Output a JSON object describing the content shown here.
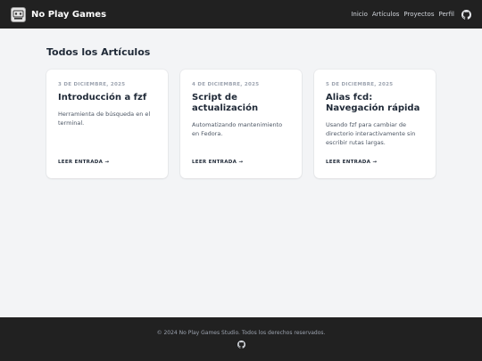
{
  "header": {
    "site_title": "No Play Games",
    "logo_icon": "brand-logo-icon",
    "nav": [
      "Inicio",
      "Artículos",
      "Proyectos",
      "Perfil"
    ],
    "github_icon": "github-icon"
  },
  "main": {
    "section_title": "Todos los Artículos",
    "articles": [
      {
        "date": "3 DE DICIEMBRE, 2025",
        "title": "Introducción a fzf",
        "description": "Herramienta de búsqueda en el terminal.",
        "link": "LEER ENTRADA →"
      },
      {
        "date": "4 DE DICIEMBRE, 2025",
        "title": "Script de actualización",
        "description": "Automatizando mantenimiento en Fedora.",
        "link": "LEER ENTRADA →"
      },
      {
        "date": "5 DE DICIEMBRE, 2025",
        "title": "Alias fcd: Navegación rápida",
        "description": "Usando fzf para cambiar de directorio interactivamente sin escribir rutas largas.",
        "link": "LEER ENTRADA →"
      }
    ]
  },
  "footer": {
    "copyright": "© 2024 No Play Games Studio. Todos los derechos reservados.",
    "github_icon": "github-icon"
  },
  "colors": {
    "header_bg": "#212121",
    "page_bg": "#f3f4f6",
    "card_bg": "#ffffff",
    "text_dark": "#1f2937",
    "text_muted": "#9ca3af"
  }
}
